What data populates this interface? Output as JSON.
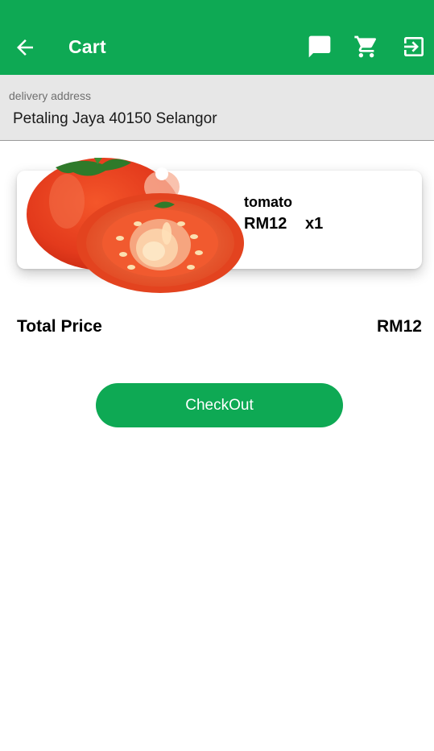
{
  "app_bar": {
    "title": "Cart",
    "background_color": "#0ea954",
    "back_icon": "arrow-left-icon",
    "actions": [
      {
        "icon": "chat-icon"
      },
      {
        "icon": "cart-icon"
      },
      {
        "icon": "logout-icon"
      }
    ]
  },
  "delivery": {
    "label": "delivery address",
    "value": "Petaling Jaya 40150 Selangor"
  },
  "cart_items": [
    {
      "name": "tomato",
      "price": "RM12",
      "quantity": "x1",
      "image": "tomato-image"
    }
  ],
  "total": {
    "label": "Total Price",
    "value": "RM12"
  },
  "checkout_button": {
    "label": "CheckOut",
    "color": "#0ea954"
  }
}
